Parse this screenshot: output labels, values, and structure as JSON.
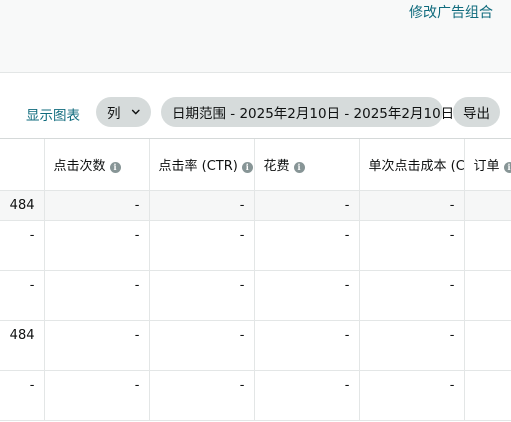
{
  "header": {
    "edit_link": "修改广告组合"
  },
  "toolbar": {
    "show_chart": "显示图表",
    "columns_label": "列",
    "date_range": "日期范围 - 2025年2月10日 - 2025年2月10日",
    "export_label": "导出"
  },
  "table": {
    "columns": [
      "点击次数",
      "点击率 (CTR)",
      "花费",
      "单次点击成本 (CPC)",
      "订单"
    ],
    "total_row": [
      "484",
      "-",
      "-",
      "-",
      "-",
      ""
    ],
    "rows": [
      [
        "-",
        "-",
        "-",
        "-",
        "-",
        ""
      ],
      [
        "-",
        "-",
        "-",
        "-",
        "-",
        ""
      ],
      [
        "484",
        "-",
        "-",
        "-",
        "-",
        ""
      ],
      [
        "-",
        "-",
        "-",
        "-",
        "-",
        ""
      ]
    ]
  },
  "colors": {
    "link": "#0f6b7d",
    "pill": "#d6dbdb",
    "info_icon": "#879596"
  }
}
